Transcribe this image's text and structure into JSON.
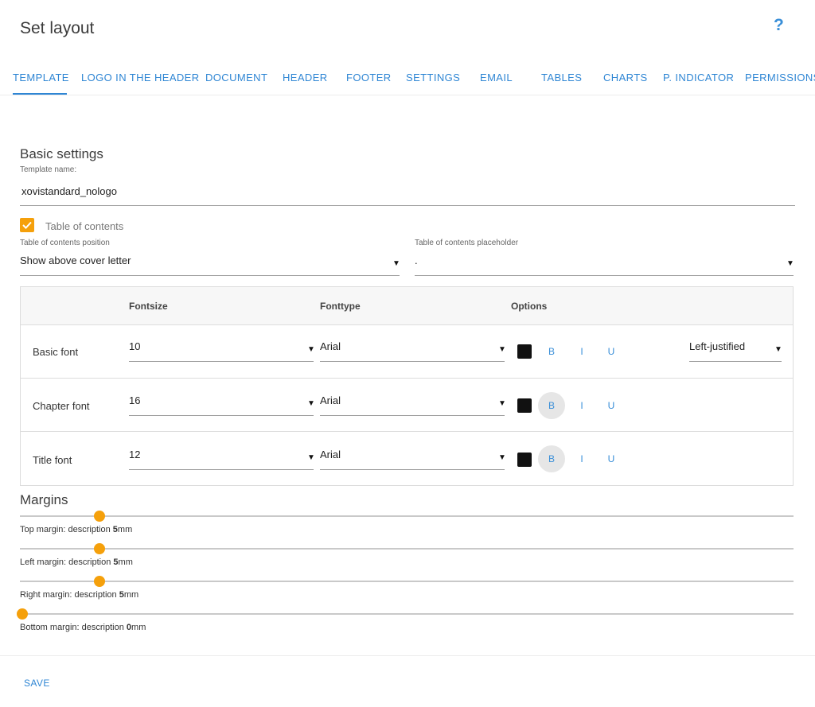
{
  "header": {
    "title": "Set layout",
    "help_label": "?"
  },
  "tabs": [
    {
      "label": "TEMPLATE",
      "active": true
    },
    {
      "label": "LOGO IN THE HEADER",
      "active": false
    },
    {
      "label": "DOCUMENT",
      "active": false
    },
    {
      "label": "HEADER",
      "active": false
    },
    {
      "label": "FOOTER",
      "active": false
    },
    {
      "label": "SETTINGS",
      "active": false
    },
    {
      "label": "EMAIL",
      "active": false
    },
    {
      "label": "TABLES",
      "active": false
    },
    {
      "label": "CHARTS",
      "active": false
    },
    {
      "label": "P. INDICATOR",
      "active": false
    },
    {
      "label": "PERMISSIONS",
      "active": false
    }
  ],
  "basic": {
    "title": "Basic settings",
    "template_name_label": "Template name:",
    "template_name_value": "xovistandard_nologo",
    "toc_checked": true,
    "toc_label": "Table of contents",
    "toc_position_label": "Table of contents position",
    "toc_position_value": "Show above cover letter",
    "toc_placeholder_label": "Table of contents placeholder",
    "toc_placeholder_value": "."
  },
  "font_table": {
    "headers": {
      "fontsize": "Fontsize",
      "fonttype": "Fonttype",
      "options": "Options"
    },
    "rows": [
      {
        "label": "Basic font",
        "size": "10",
        "type": "Arial",
        "bold": false,
        "alignment": "Left-justified"
      },
      {
        "label": "Chapter font",
        "size": "16",
        "type": "Arial",
        "bold": true
      },
      {
        "label": "Title font",
        "size": "12",
        "type": "Arial",
        "bold": true
      }
    ],
    "option_labels": {
      "bold": "B",
      "italic": "I",
      "underline": "U"
    },
    "color": "#111111"
  },
  "margins": {
    "title": "Margins",
    "unit": "mm",
    "items": [
      {
        "caption": "Top margin: description",
        "value": "5"
      },
      {
        "caption": "Left margin: description",
        "value": "5"
      },
      {
        "caption": "Right margin: description",
        "value": "5"
      },
      {
        "caption": "Bottom margin: description",
        "value": "0"
      }
    ]
  },
  "footer": {
    "save_label": "SAVE"
  },
  "colors": {
    "accent": "#2f86d4",
    "checkbox": "#f5a00b",
    "slider": "#f5a00b"
  }
}
